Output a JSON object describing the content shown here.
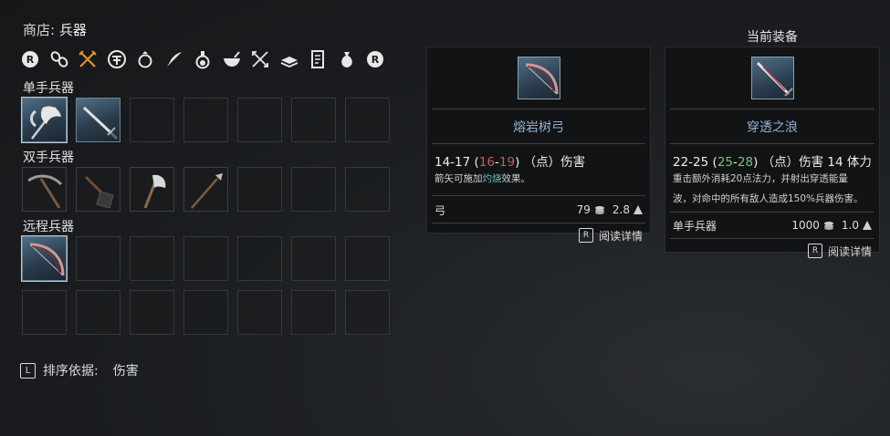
{
  "shop": {
    "title_prefix": "商店:",
    "title_name": "兵器"
  },
  "category_bar": {
    "left_button": "R",
    "right_button": "R",
    "icons": [
      "chain-icon",
      "crossed-weapons-icon",
      "armor-emblem-icon",
      "ring-icon",
      "feather-quill-icon",
      "potion-flask-icon",
      "bowl-icon",
      "crossed-arrows-icon",
      "book-stack-icon",
      "scroll-icon",
      "sack-icon"
    ]
  },
  "sections": [
    {
      "label": "单手兵器",
      "items": [
        "battle-axe",
        "sword"
      ],
      "slots": 7
    },
    {
      "label": "双手兵器",
      "items": [
        "pickaxe",
        "shovel",
        "axe",
        "spear"
      ],
      "slots": 7
    },
    {
      "label": "远程兵器",
      "items": [
        "bow"
      ],
      "slots": 14
    }
  ],
  "sort": {
    "key": "L",
    "label": "排序依据:",
    "value": "伤害"
  },
  "selected_item": {
    "name": "熔岩树弓",
    "damage_base": "14-17",
    "damage_open": "(",
    "damage_alt_min": "16",
    "damage_alt_sep": "-",
    "damage_alt_max": "19",
    "damage_close": ")",
    "damage_suffix": "（点）伤害",
    "desc_pre": "箭矢可施加",
    "desc_highlight": "灼烧",
    "desc_post": "效果。",
    "type": "弓",
    "price": "79",
    "weight": "2.8",
    "read_key": "R",
    "read_label": "阅读详情"
  },
  "current_equipment": {
    "header": "当前装备",
    "name": "穿透之浪",
    "damage_base": "22-25",
    "damage_open": "(",
    "damage_alt_min": "25",
    "damage_alt_sep": "-",
    "damage_alt_max": "28",
    "damage_close": ")",
    "damage_suffix": "（点）伤害 14 体力",
    "desc_line1": "重击额外消耗20点法力，并射出穿透能量",
    "desc_line2": "波，对命中的所有敌人造成150%兵器伤害。",
    "type": "单手兵器",
    "price": "1000",
    "weight": "1.0",
    "read_key": "R",
    "read_label": "阅读详情"
  },
  "colors": {
    "accent_orange": "#e0932d",
    "name_blue": "#8fb3d6",
    "alt_red": "#d05757",
    "alt_green": "#7fbf7f",
    "effect_teal": "#6fbfc0"
  }
}
